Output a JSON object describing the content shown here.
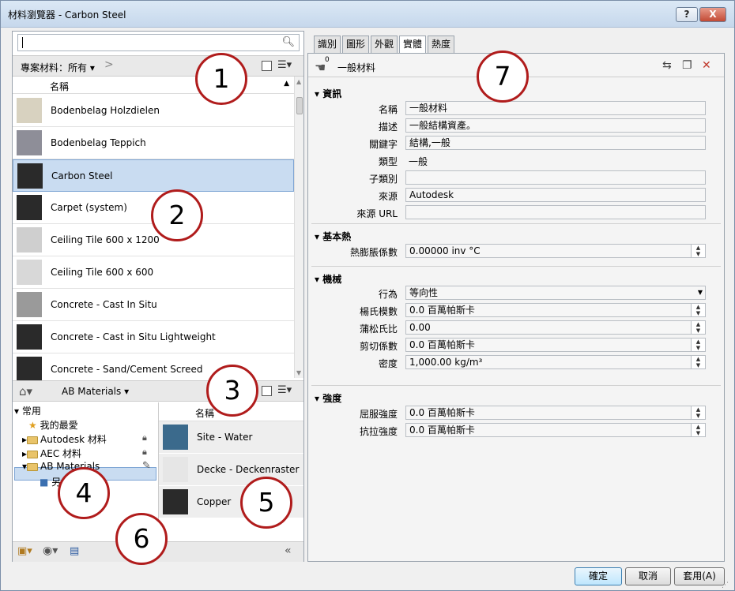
{
  "window": {
    "title": "材料瀏覽器 - Carbon Steel",
    "help": "?",
    "close": "X"
  },
  "library": {
    "crumb": "專案材料：所有",
    "column_name": "名稱",
    "materials": [
      {
        "label": "Bodenbelag Holzdielen",
        "color": "#d8d2c0"
      },
      {
        "label": "Bodenbelag Teppich",
        "color": "#8e8e98"
      },
      {
        "label": "Carbon Steel",
        "color": "#2a2a2a",
        "selected": true
      },
      {
        "label": "Carpet (system)",
        "color": "#2a2a2a"
      },
      {
        "label": "Ceiling Tile 600 x 1200",
        "color": "#cfcfcf"
      },
      {
        "label": "Ceiling Tile 600 x 600",
        "color": "#d8d8d8"
      },
      {
        "label": "Concrete - Cast In Situ",
        "color": "#9a9a9a"
      },
      {
        "label": "Concrete - Cast in Situ Lightweight",
        "color": "#2a2a2a"
      },
      {
        "label": "Concrete - Sand/Cement Screed",
        "color": "#2a2a2a"
      }
    ]
  },
  "lower": {
    "crumb": "AB Materials",
    "tree": {
      "root": "常用",
      "favorites": "我的最愛",
      "autodesk": "Autodesk 材料",
      "aec": "AEC 材料",
      "ab": "AB Materials",
      "child": "另"
    },
    "column_name": "名稱",
    "items": [
      {
        "label": "Site - Water",
        "color": "#3b6a8c"
      },
      {
        "label": "Decke - Deckenraster",
        "color": "#e6e6e6"
      },
      {
        "label": "Copper",
        "color": "#2a2a2a"
      }
    ]
  },
  "tabs": [
    "識別",
    "圖形",
    "外觀",
    "實體",
    "熱度"
  ],
  "active_tab": "實體",
  "asset": {
    "count": "0",
    "name": "一般材料"
  },
  "info": {
    "section": "資訊",
    "name_label": "名稱",
    "name_value": "一般材料",
    "desc_label": "描述",
    "desc_value": "一般結構資產。",
    "keywords_label": "關鍵字",
    "keywords_value": "結構,一般",
    "type_label": "類型",
    "type_value": "一般",
    "subclass_label": "子類別",
    "subclass_value": "",
    "source_label": "來源",
    "source_value": "Autodesk",
    "url_label": "來源 URL",
    "url_value": ""
  },
  "thermal": {
    "section": "基本熱",
    "exp_label": "熱膨脹係數",
    "exp_value": "0.00000 inv °C"
  },
  "mech": {
    "section": "機械",
    "behavior_label": "行為",
    "behavior_value": "等向性",
    "young_label": "楊氏模數",
    "young_value": "0.0 百萬帕斯卡",
    "poisson_label": "蒲松氏比",
    "poisson_value": "0.00",
    "shear_label": "剪切係數",
    "shear_value": "0.0 百萬帕斯卡",
    "density_label": "密度",
    "density_value": "1,000.00 kg/m³"
  },
  "strength": {
    "section": "強度",
    "yield_label": "屈服強度",
    "yield_value": "0.0 百萬帕斯卡",
    "tensile_label": "抗拉強度",
    "tensile_value": "0.0 百萬帕斯卡"
  },
  "buttons": {
    "ok": "確定",
    "cancel": "取消",
    "apply": "套用(A)"
  },
  "callouts": [
    "1",
    "2",
    "3",
    "4",
    "5",
    "6",
    "7"
  ]
}
